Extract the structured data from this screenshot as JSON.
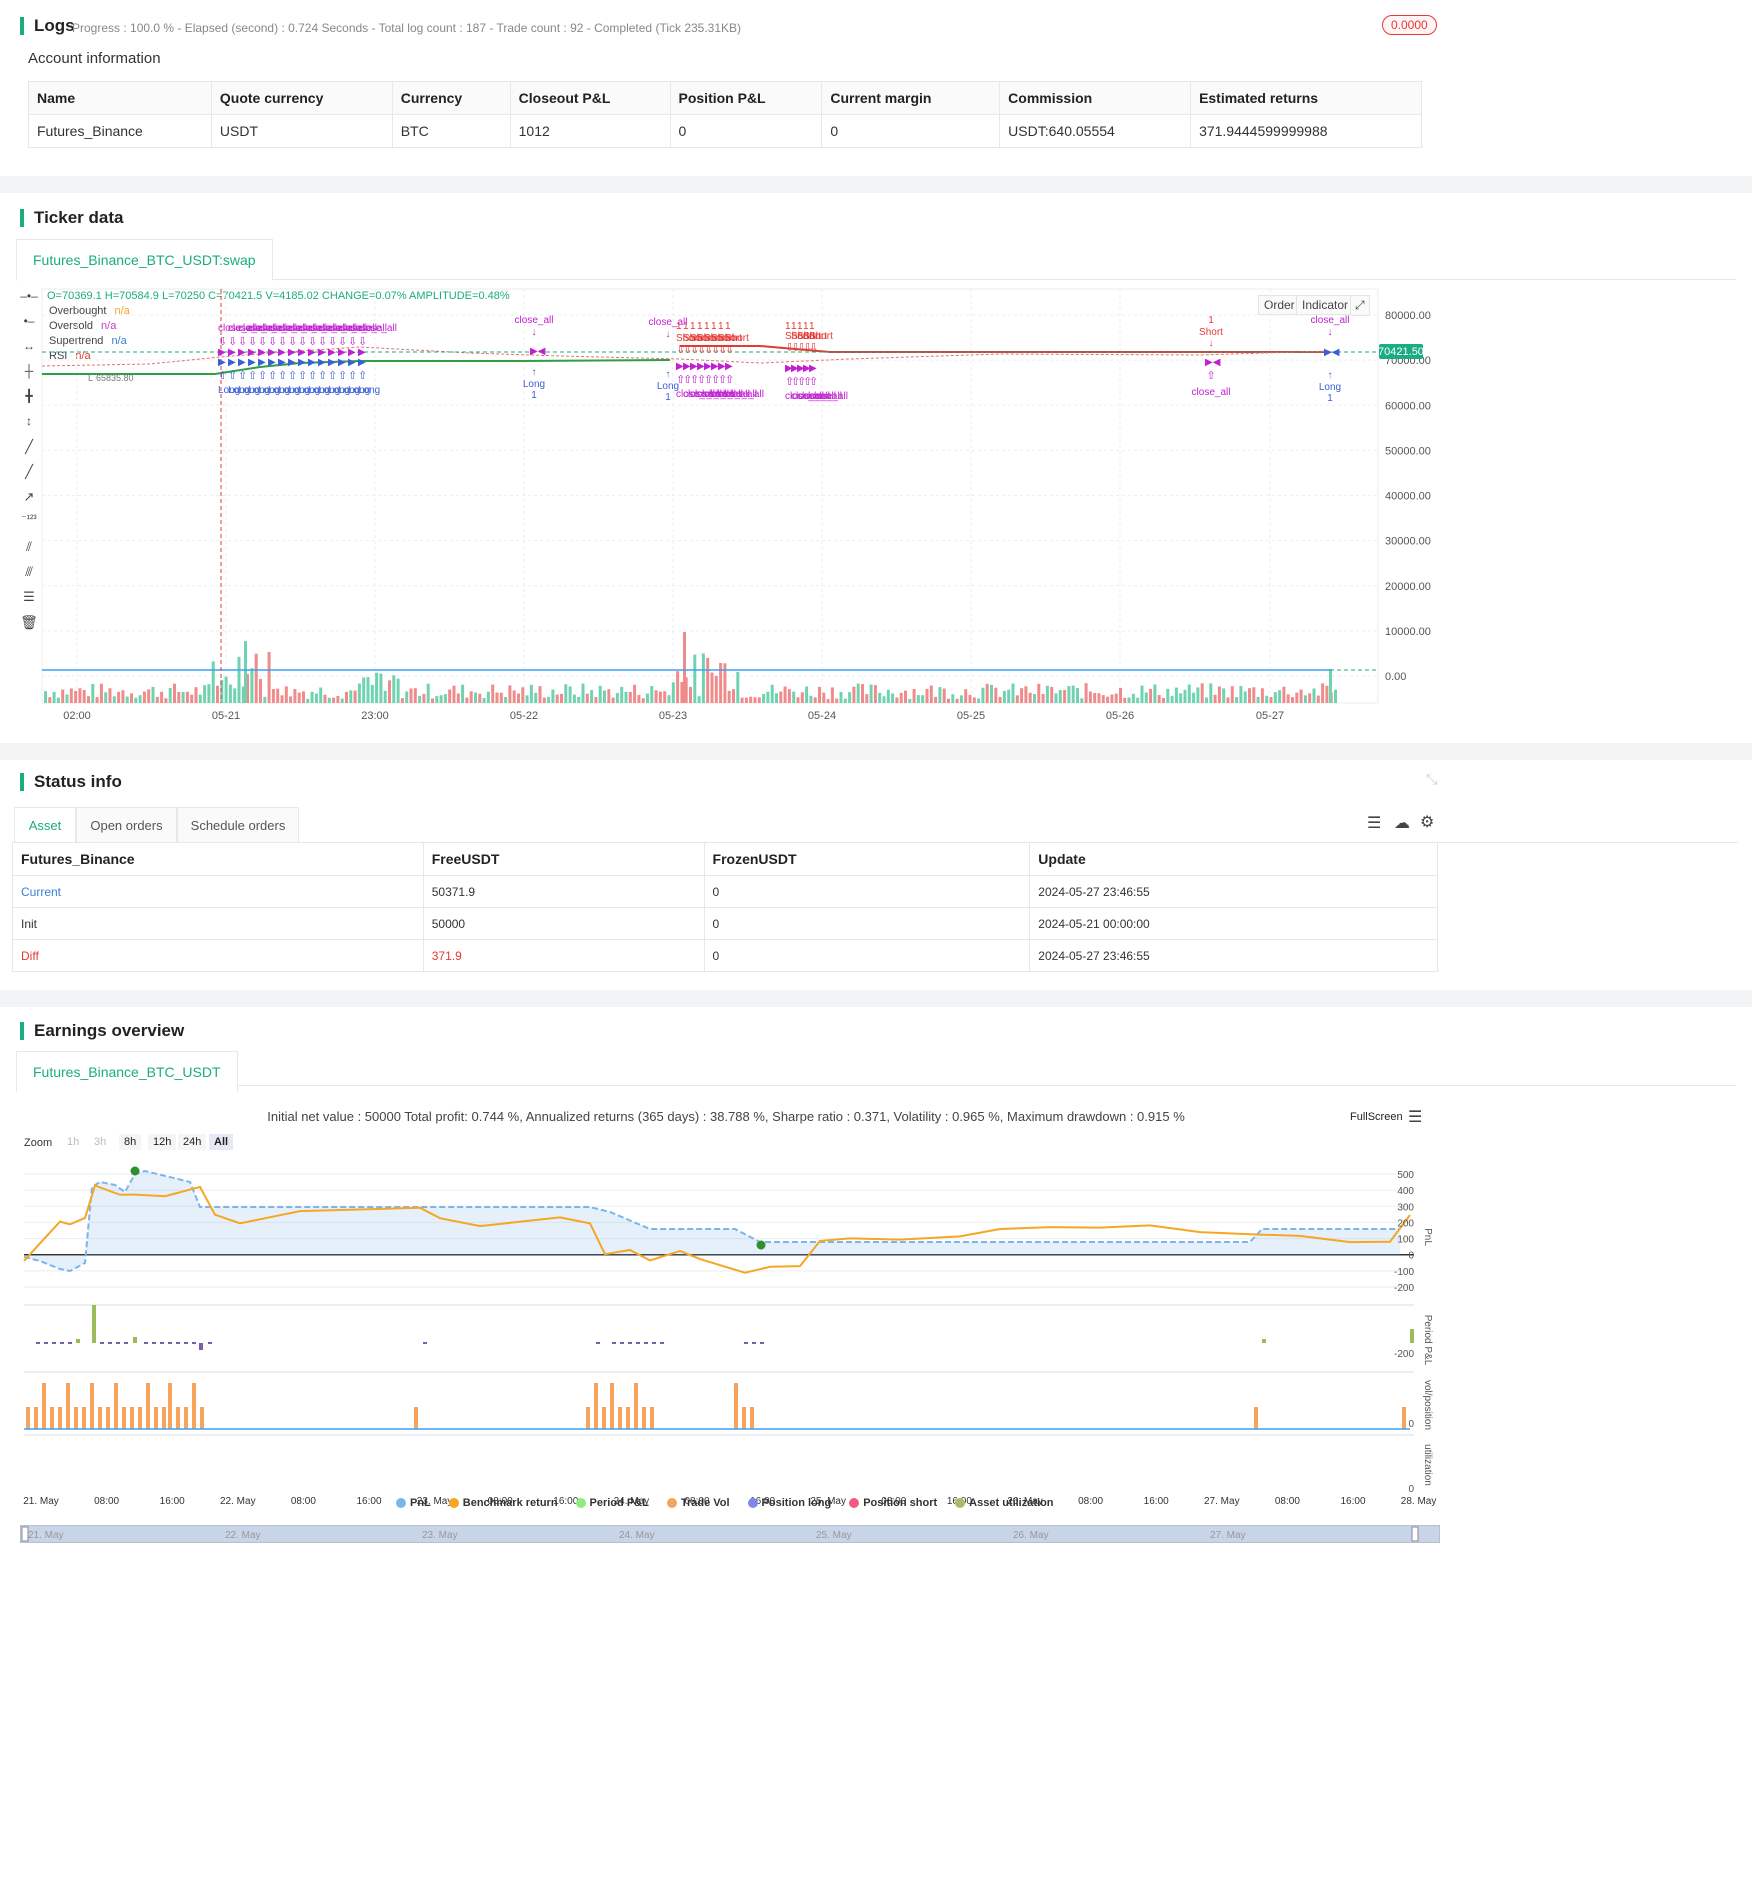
{
  "logs": {
    "title": "Logs",
    "progress_text": "Progress : 100.0 % - Elapsed (second) : 0.724  Seconds - Total log count : 187 - Trade count : 92 - Completed (Tick 235.31KB)",
    "badge": "0.0000",
    "account_title": "Account information",
    "columns": [
      "Name",
      "Quote currency",
      "Currency",
      "Closeout P&L",
      "Position P&L",
      "Current margin",
      "Commission",
      "Estimated returns"
    ],
    "row": [
      "Futures_Binance",
      "USDT",
      "BTC",
      "1012",
      "0",
      "0",
      "USDT:640.05554",
      "371.9444599999988"
    ]
  },
  "ticker": {
    "title": "Ticker data",
    "tab": "Futures_Binance_BTC_USDT:swap",
    "ohlc_prefix": "O=70369.1 H=70584.9 L=70250 C=70421.5 V=4185.02 CHANGE=0.07% AMPLITUDE=0.48%",
    "legend": [
      {
        "name": "Overbought",
        "value": "n/a",
        "color": "#f5a623"
      },
      {
        "name": "Oversold",
        "value": "n/a",
        "color": "#c040c0"
      },
      {
        "name": "Supertrend",
        "value": "n/a",
        "color": "#3a7fd5"
      },
      {
        "name": "RSI",
        "value": "n/a",
        "color": "#e53935"
      }
    ],
    "buttons": {
      "order": "Order",
      "indicator": "Indicator"
    },
    "price_badge": "70421.50",
    "low_label": "65835.80",
    "y_ticks": [
      "80000.00",
      "70000.00",
      "60000.00",
      "50000.00",
      "40000.00",
      "30000.00",
      "20000.00",
      "10000.00",
      "0.00"
    ],
    "x_ticks": [
      "02:00",
      "05-21",
      "23:00",
      "05-22",
      "05-23",
      "05-24",
      "05-25",
      "05-26",
      "05-27"
    ],
    "signals": {
      "long": "Long",
      "short": "Short",
      "close": "close_all",
      "one": "1"
    }
  },
  "status": {
    "title": "Status info",
    "tabs": [
      "Asset",
      "Open orders",
      "Schedule orders"
    ],
    "columns": [
      "Futures_Binance",
      "FreeUSDT",
      "FrozenUSDT",
      "Update"
    ],
    "rows": [
      [
        "Current",
        "50371.9",
        "0",
        "2024-05-27 23:46:55"
      ],
      [
        "Init",
        "50000",
        "0",
        "2024-05-21 00:00:00"
      ],
      [
        "Diff",
        "371.9",
        "0",
        "2024-05-27 23:46:55"
      ]
    ]
  },
  "earnings": {
    "title": "Earnings overview",
    "tab": "Futures_Binance_BTC_USDT",
    "summary": "Initial net value : 50000 Total profit: 0.744 %, Annualized returns (365 days) : 38.788 %, Sharpe ratio : 0.371, Volatility : 0.965 %, Maximum drawdown : 0.915 %",
    "fullscreen": "FullScreen",
    "zoom_label": "Zoom",
    "zoom_options": [
      "1h",
      "3h",
      "8h",
      "12h",
      "24h",
      "All"
    ],
    "pnl_ticks": [
      "500",
      "400",
      "300",
      "200",
      "100",
      "0",
      "-100",
      "-200"
    ],
    "period_ticks": [
      "-200"
    ],
    "vol_ticks": [
      "0"
    ],
    "util_ticks": [
      "0"
    ],
    "axis_labels": [
      "PnL",
      "Period P&L",
      "vol/position",
      "utilization"
    ],
    "x_ticks": [
      "21. May",
      "08:00",
      "16:00",
      "22. May",
      "08:00",
      "16:00",
      "23. May",
      "08:00",
      "16:00",
      "24. May",
      "08:00",
      "16:00",
      "25. May",
      "08:00",
      "16:00",
      "26. May",
      "08:00",
      "16:00",
      "27. May",
      "08:00",
      "16:00",
      "28. May"
    ],
    "legend": [
      {
        "name": "PnL",
        "color": "#7cb5ec"
      },
      {
        "name": "Benchmark return",
        "color": "#f5a623"
      },
      {
        "name": "Period P&L",
        "color": "#90ed7d"
      },
      {
        "name": "Trade Vol",
        "color": "#f7a35c"
      },
      {
        "name": "Position long",
        "color": "#8085e9"
      },
      {
        "name": "Position short",
        "color": "#f15c80"
      },
      {
        "name": "Asset utilization",
        "color": "#b5b56a"
      }
    ],
    "navigator_labels": [
      "21. May",
      "22. May",
      "23. May",
      "24. May",
      "25. May",
      "26. May",
      "27. May"
    ]
  }
}
